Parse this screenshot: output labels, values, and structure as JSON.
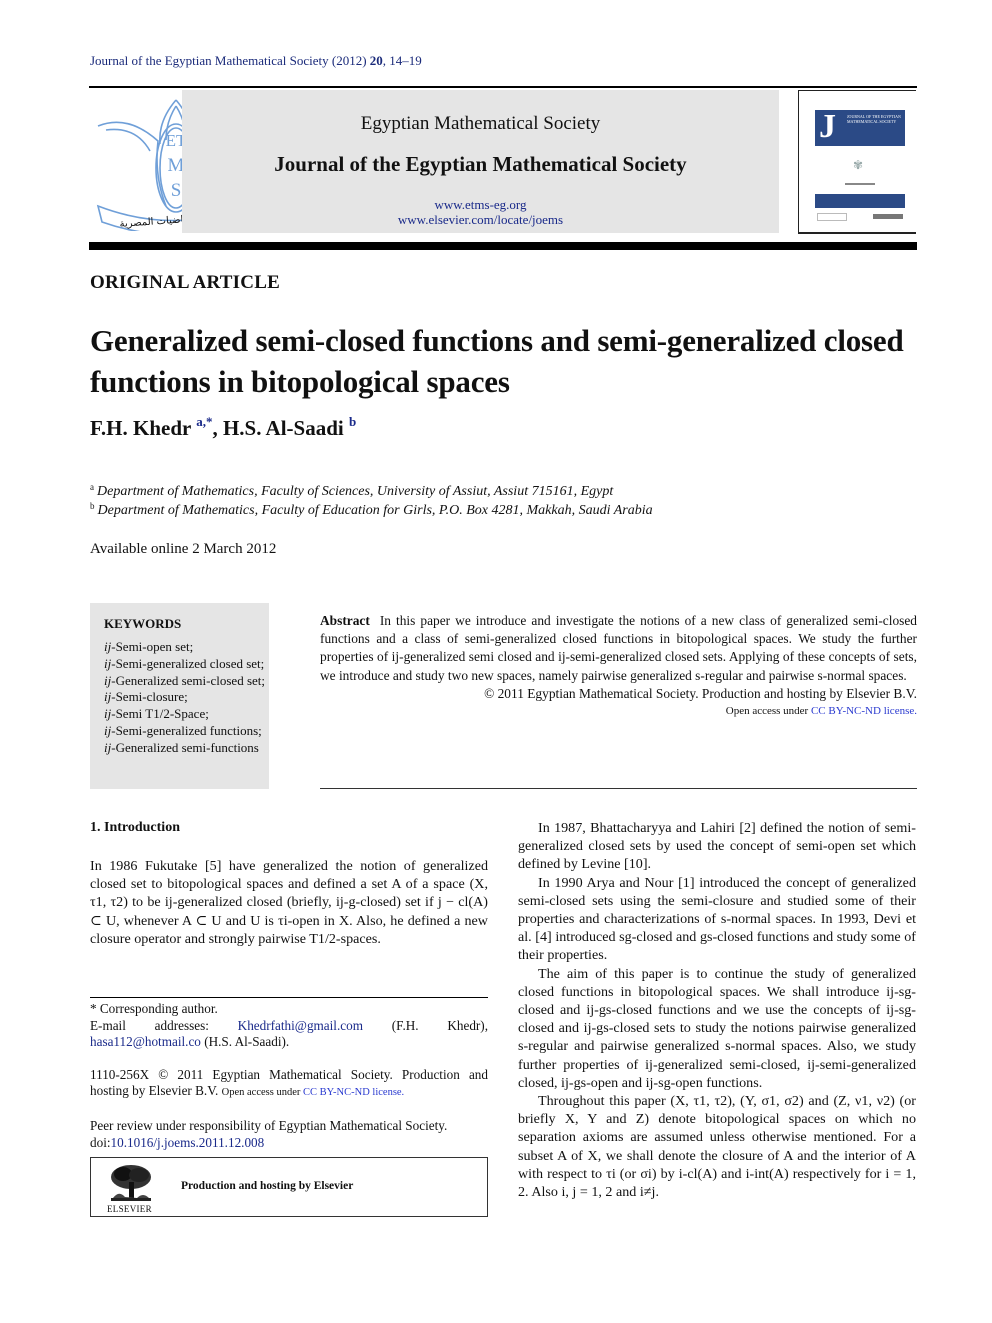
{
  "running_head": {
    "journal": "Journal of the Egyptian Mathematical Society (2012)",
    "volume": "20",
    "pages": ", 14–19"
  },
  "masthead": {
    "logo_letters": [
      "ET",
      "M",
      "S"
    ],
    "logo_arabic": "الجمعية الرياضيات المصرية",
    "society": "Egyptian Mathematical Society",
    "journal": "Journal of the Egyptian Mathematical Society",
    "url1": "www.etms-eg.org",
    "url2": "www.elsevier.com/locate/joems",
    "cover": {
      "letter": "J",
      "title_lines": "JOURNAL OF THE EGYPTIAN MATHEMATICAL SOCIETY"
    }
  },
  "article": {
    "type": "ORIGINAL ARTICLE",
    "title": "Generalized semi-closed functions and semi-generalized closed functions in bitopological spaces",
    "authors": [
      {
        "name": "F.H. Khedr",
        "sup": "a,*"
      },
      {
        "name": "H.S. Al-Saadi",
        "sup": "b"
      }
    ],
    "author_separator": ", ",
    "affiliations": [
      {
        "sup": "a",
        "text": "Department of Mathematics, Faculty of Sciences, University of Assiut, Assiut 715161, Egypt"
      },
      {
        "sup": "b",
        "text": "Department of Mathematics, Faculty of Education for Girls, P.O. Box 4281, Makkah, Saudi Arabia"
      }
    ],
    "available_online": "Available online 2 March 2012"
  },
  "keywords": {
    "heading": "KEYWORDS",
    "items": [
      {
        "prefix": "ij",
        "text": "-Semi-open set;"
      },
      {
        "prefix": "ij",
        "text": "-Semi-generalized closed set;"
      },
      {
        "prefix": "ij",
        "text": "-Generalized semi-closed set;"
      },
      {
        "prefix": "ij",
        "text": "-Semi-closure;"
      },
      {
        "prefix": "ij",
        "text": "-Semi T1/2-Space;"
      },
      {
        "prefix": "ij",
        "text": "-Semi-generalized functions;"
      },
      {
        "prefix": "ij",
        "text": "-Generalized semi-functions"
      }
    ]
  },
  "abstract": {
    "label": "Abstract",
    "text": "In this paper we introduce and investigate the notions of a new class of generalized semi-closed functions and a class of semi-generalized closed functions in bitopological spaces. We study the further properties of ij-generalized semi closed and ij-semi-generalized closed sets. Applying of these concepts of sets, we introduce and study two new spaces, namely pairwise generalized s-regular and pairwise s-normal spaces.",
    "copyright": "© 2011 Egyptian Mathematical Society. Production and hosting by Elsevier B.V.",
    "open_access_prefix": "Open access under ",
    "license": "CC BY-NC-ND license."
  },
  "introduction": {
    "heading": "1. Introduction",
    "left_paragraph": "In 1986 Fukutake [5] have generalized the notion of generalized closed set to bitopological spaces and defined a set A of a space (X, τ1, τ2) to be ij-generalized closed (briefly, ij-g-closed) set if j − cl(A) ⊂ U, whenever A ⊂ U and U is τi-open in X. Also, he defined a new closure operator and strongly pairwise T1/2-spaces.",
    "right_paragraphs": [
      "In 1987, Bhattacharyya and Lahiri [2] defined the notion of semi-generalized closed sets by used the concept of semi-open set which defined by Levine [10].",
      "In 1990 Arya and Nour [1] introduced the concept of generalized semi-closed sets using the semi-closure and studied some of their properties and characterizations of s-normal spaces. In 1993, Devi et al. [4] introduced sg-closed and gs-closed functions and study some of their properties.",
      "The aim of this paper is to continue the study of generalized closed functions in bitopological spaces. We shall introduce ij-sg-closed and ij-gs-closed functions and we use the concepts of ij-sg-closed and ij-gs-closed sets to study the notions pairwise generalized s-regular and pairwise generalized s-normal spaces. Also, we study further properties of ij-generalized semi-closed, ij-semi-generalized closed, ij-gs-open and ij-sg-open functions.",
      "Throughout this paper (X, τ1, τ2), (Y, σ1, σ2) and (Z, ν1, ν2) (or briefly X, Y and Z) denote bitopological spaces on which no separation axioms are assumed unless otherwise mentioned. For a subset A of X, we shall denote the closure of A and the interior of A with respect to τi (or σi) by i-cl(A) and i-int(A) respectively for i = 1, 2. Also i, j = 1, 2 and i≠j."
    ],
    "citations": [
      "[5]",
      "[2]",
      "[10]",
      "[1]",
      "[4]"
    ]
  },
  "footnotes": {
    "corresponding_marker": "*",
    "corresponding": "Corresponding author.",
    "email_label": "E-mail addresses: ",
    "email1": "Khedrfathi@gmail.com",
    "email1_owner": " (F.H. Khedr), ",
    "email2": "hasa112@hotmail.co",
    "email2_owner": " (H.S. Al-Saadi).",
    "issn_line": "1110-256X © 2011 Egyptian Mathematical Society. Production and hosting by Elsevier B.V. ",
    "open_access_prefix": "Open access under ",
    "license": "CC BY-NC-ND license.",
    "peer_review": "Peer review under responsibility of Egyptian Mathematical Society.",
    "doi_label": "doi:",
    "doi": "10.1016/j.joems.2011.12.008"
  },
  "elsevier_box": {
    "wordmark": "ELSEVIER",
    "caption": "Production and hosting by Elsevier"
  },
  "colors": {
    "link": "#1a2a8a",
    "license_link": "#2a3ad0",
    "panel_gray": "#e5e5e5",
    "logo_blue": "#6f9fd8",
    "cover_blue": "#2b4a86"
  }
}
